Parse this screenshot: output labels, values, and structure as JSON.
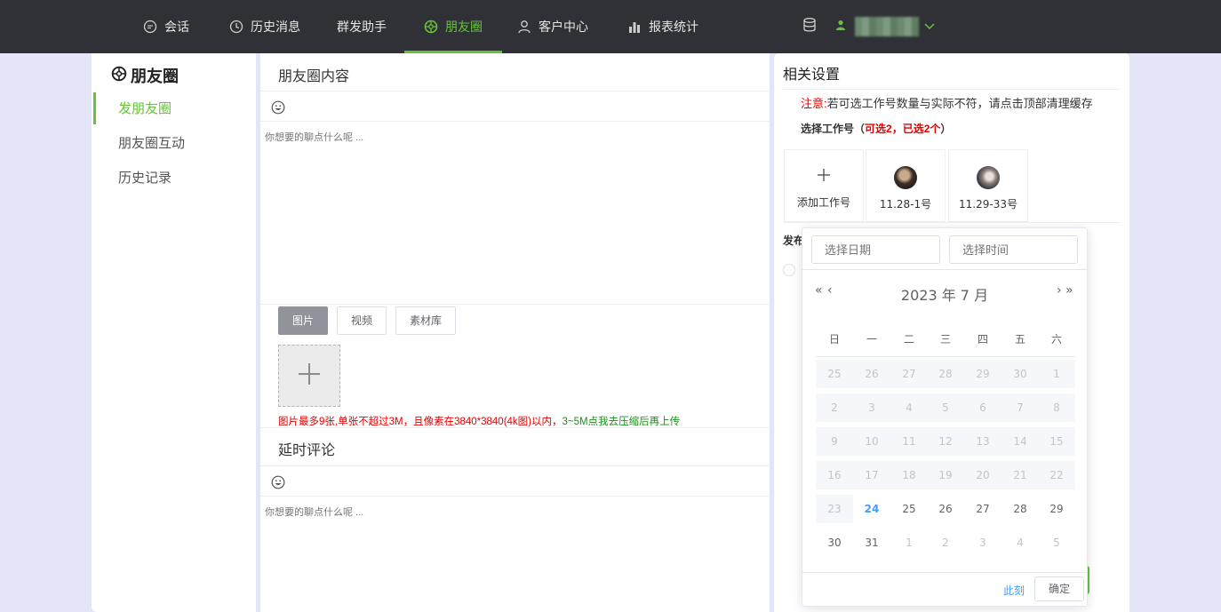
{
  "nav": {
    "items": [
      {
        "label": "会话",
        "icon": "chat-icon"
      },
      {
        "label": "历史消息",
        "icon": "clock-icon"
      },
      {
        "label": "群发助手",
        "icon": ""
      },
      {
        "label": "朋友圈",
        "icon": "aperture-icon"
      },
      {
        "label": "客户中心",
        "icon": "user-icon"
      },
      {
        "label": "报表统计",
        "icon": "bar-chart-icon"
      }
    ],
    "active_index": 3,
    "accent": "#67c23a"
  },
  "sidebar": {
    "title": "朋友圈",
    "items": [
      {
        "label": "发朋友圈"
      },
      {
        "label": "朋友圈互动"
      },
      {
        "label": "历史记录"
      }
    ],
    "active_index": 0
  },
  "content": {
    "section_title": "朋友圈内容",
    "placeholder": "你想要的聊点什么呢 ...",
    "media_tabs": [
      "图片",
      "视频",
      "素材库"
    ],
    "tip_red": "图片最多9张,单张不超过3M，且像素在3840*3840(4k图)以内，",
    "tip_green": "3~5M点我去压缩后再上传",
    "delay_title": "延时评论",
    "delay_placeholder": "你想要的聊点什么呢 ..."
  },
  "settings": {
    "title": "相关设置",
    "notice_prefix": "注意:",
    "notice_text": "若可选工作号数量与实际不符，请点击顶部清理缓存",
    "select_label": "选择工作号（",
    "select_count": "可选2，已选2个",
    "select_close": "）",
    "accounts": [
      {
        "label": "添加工作号",
        "type": "add"
      },
      {
        "label": "11.28-1号",
        "type": "avatar"
      },
      {
        "label": "11.29-33号",
        "type": "avatar"
      }
    ],
    "publish_label": "发布"
  },
  "datepicker": {
    "date_placeholder": "选择日期",
    "time_placeholder": "选择时间",
    "header": "2023 年  7 月",
    "weekdays": [
      "日",
      "一",
      "二",
      "三",
      "四",
      "五",
      "六"
    ],
    "rows": [
      [
        "25",
        "26",
        "27",
        "28",
        "29",
        "30",
        "1"
      ],
      [
        "2",
        "3",
        "4",
        "5",
        "6",
        "7",
        "8"
      ],
      [
        "9",
        "10",
        "11",
        "12",
        "13",
        "14",
        "15"
      ],
      [
        "16",
        "17",
        "18",
        "19",
        "20",
        "21",
        "22"
      ],
      [
        "23",
        "24",
        "25",
        "26",
        "27",
        "28",
        "29"
      ],
      [
        "30",
        "31",
        "1",
        "2",
        "3",
        "4",
        "5"
      ]
    ],
    "today": "24",
    "now_label": "此刻",
    "ok_label": "确定"
  }
}
